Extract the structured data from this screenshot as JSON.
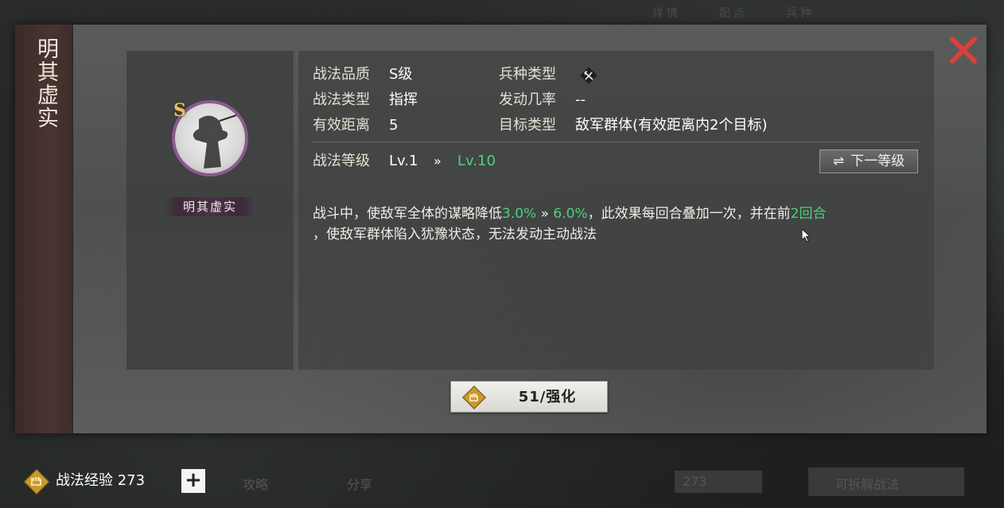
{
  "background": {
    "top_tabs": [
      "详情",
      "配点",
      "兵种"
    ],
    "bottom_ghost": {
      "item_a": "攻略",
      "item_b": "分享",
      "exp_value": "273",
      "action": "可拆解战法"
    }
  },
  "dialog": {
    "side_title": "明其虚实",
    "close_icon": "close-x-icon",
    "skill_card": {
      "grade": "S",
      "name": "明其虚实",
      "ring_color": "#8b5a8f"
    },
    "info": {
      "quality_label": "战法品质",
      "quality_value": "S级",
      "troop_label": "兵种类型",
      "troop_icon": "bow-icon",
      "type_label": "战法类型",
      "type_value": "指挥",
      "trigger_label": "发动几率",
      "trigger_value": "--",
      "range_label": "有效距离",
      "range_value": "5",
      "target_label": "目标类型",
      "target_value": "敌军群体(有效距离内2个目标)"
    },
    "level": {
      "label": "战法等级",
      "current": "Lv.1",
      "arrow": "»",
      "next": "Lv.10",
      "next_level_button": "下一等级"
    },
    "description": {
      "part1": "战斗中，使敌军全体的谋略降低",
      "val_cur": "3.0%",
      "arrow": " » ",
      "val_next": "6.0%",
      "part2": "，此效果每回合叠加一次，并在前",
      "rounds": "2回合",
      "part3": "，使敌军群体陷入犹豫状态，无法发动主动战法"
    },
    "upgrade_button": "51/强化",
    "accent_green": "#4ecf7d",
    "close_color": "#d9423a"
  },
  "bottom": {
    "exp_label": "战法经验 273",
    "plus": "+"
  }
}
